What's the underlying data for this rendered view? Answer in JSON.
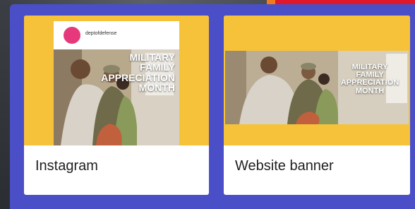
{
  "cards": [
    {
      "caption": "Instagram",
      "account": "deptofdefense",
      "overlay_lines": [
        "MILITARY",
        "FAMILY",
        "APPRECIATION",
        "MONTH"
      ]
    },
    {
      "caption": "Website banner",
      "overlay_lines": [
        "MILITARY",
        "FAMILY",
        "APPRECIATION",
        "MONTH"
      ]
    }
  ],
  "colors": {
    "panel": "#4a4fc8",
    "media_bg": "#f6c23a",
    "avatar": "#e6397c"
  }
}
